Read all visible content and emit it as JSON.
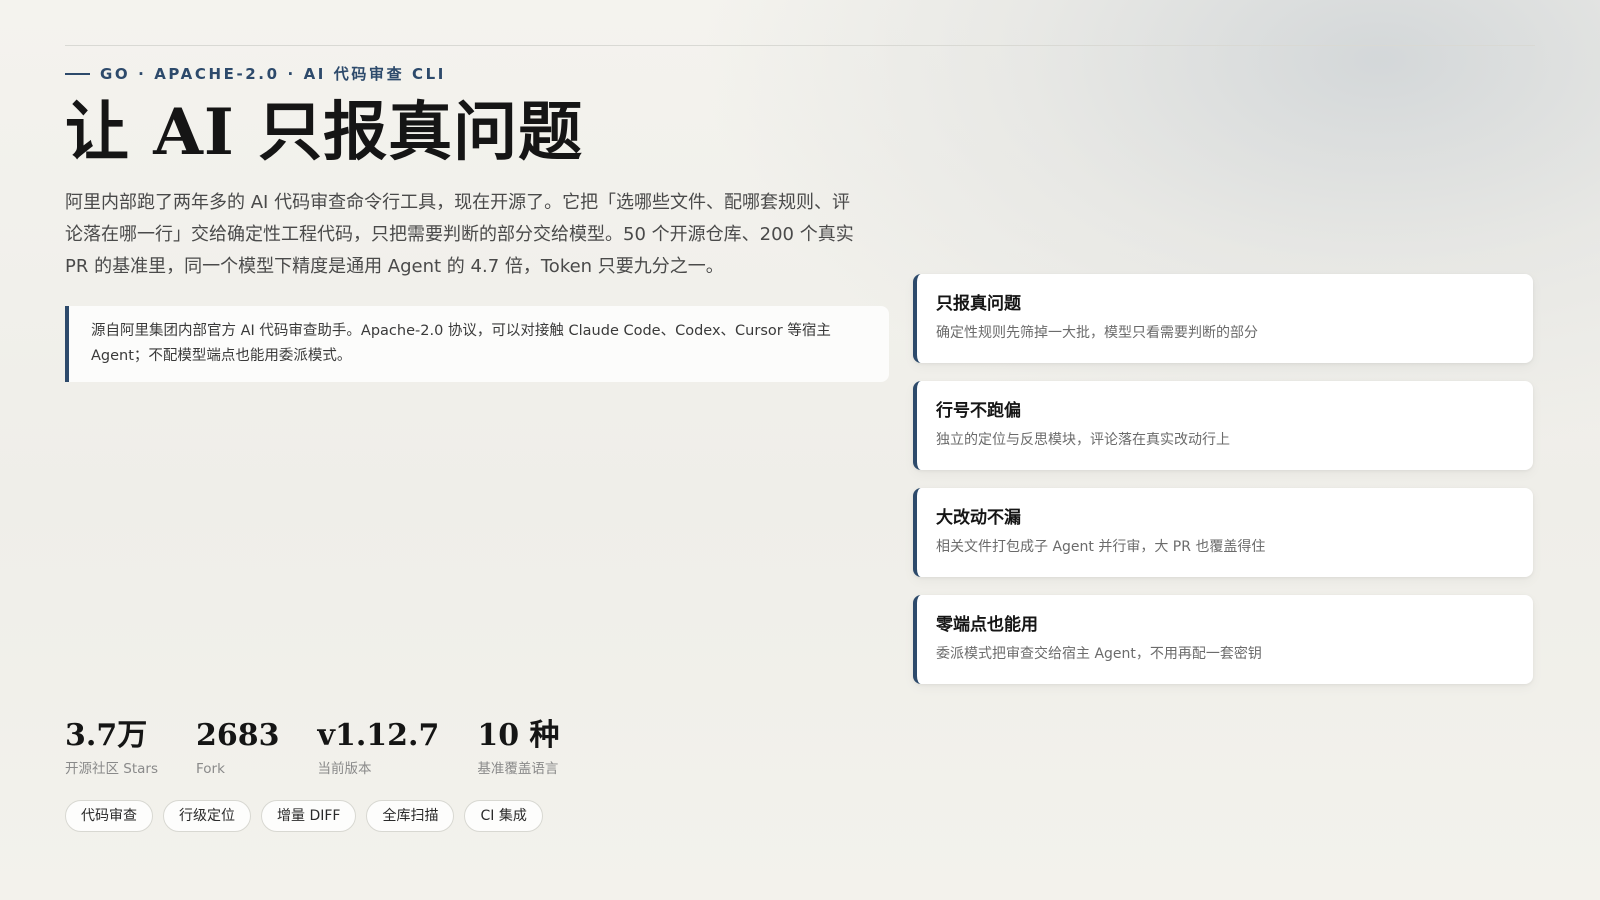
{
  "header": {
    "eyebrow": "GO · APACHE-2.0 · AI 代码审查 CLI",
    "title": "让 AI 只报真问题",
    "lead": "阿里内部跑了两年多的 AI 代码审查命令行工具，现在开源了。它把「选哪些文件、配哪套规则、评论落在哪一行」交给确定性工程代码，只把需要判断的部分交给模型。50 个开源仓库、200 个真实 PR 的基准里，同一个模型下精度是通用 Agent 的 4.7 倍，Token 只要九分之一。",
    "note": "源自阿里集团内部官方 AI 代码审查助手。Apache-2.0 协议，可以对接触 Claude Code、Codex、Cursor 等宿主 Agent；不配模型端点也能用委派模式。"
  },
  "features": [
    {
      "title": "只报真问题",
      "desc": "确定性规则先筛掉一大批，模型只看需要判断的部分"
    },
    {
      "title": "行号不跑偏",
      "desc": "独立的定位与反思模块，评论落在真实改动行上"
    },
    {
      "title": "大改动不漏",
      "desc": "相关文件打包成子 Agent 并行审，大 PR 也覆盖得住"
    },
    {
      "title": "零端点也能用",
      "desc": "委派模式把审查交给宿主 Agent，不用再配一套密钥"
    }
  ],
  "stats": [
    {
      "value": "3.7万",
      "label": "开源社区 Stars"
    },
    {
      "value": "2683",
      "label": "Fork"
    },
    {
      "value": "v1.12.7",
      "label": "当前版本"
    },
    {
      "value": "10 种",
      "label": "基准覆盖语言"
    }
  ],
  "tags": [
    "代码审查",
    "行级定位",
    "增量 DIFF",
    "全库扫描",
    "CI 集成"
  ],
  "colors": {
    "accent": "#2d4a6b",
    "background": "#f1f0eb",
    "card": "#ffffff"
  }
}
